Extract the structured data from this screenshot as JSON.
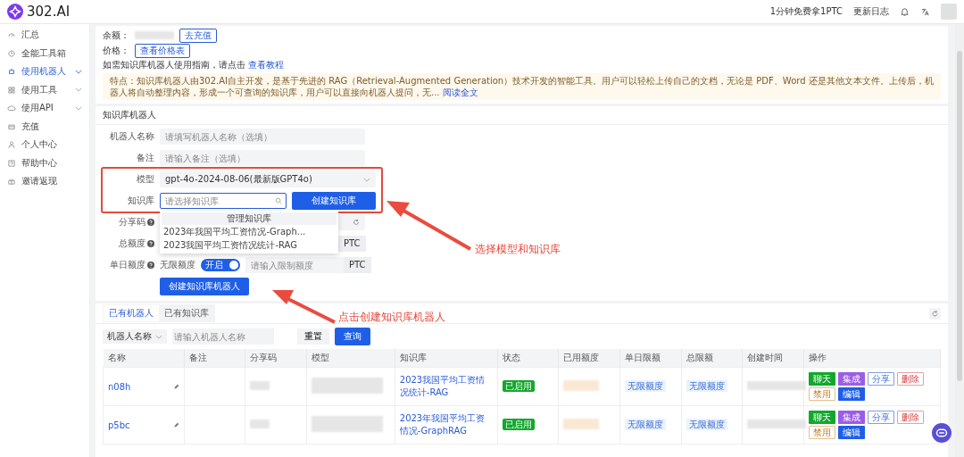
{
  "brand": {
    "name": "302.AI"
  },
  "topbar": {
    "promo": "1分钟免费拿1PTC",
    "changelog": "更新日志"
  },
  "sidebar": {
    "items": [
      {
        "label": "汇总",
        "selected": false,
        "expandable": false
      },
      {
        "label": "全能工具箱",
        "selected": false,
        "expandable": false
      },
      {
        "label": "使用机器人",
        "selected": true,
        "expandable": true
      },
      {
        "label": "使用工具",
        "selected": false,
        "expandable": true
      },
      {
        "label": "使用API",
        "selected": false,
        "expandable": true
      },
      {
        "label": "充值",
        "selected": false,
        "expandable": false
      },
      {
        "label": "个人中心",
        "selected": false,
        "expandable": false
      },
      {
        "label": "帮助中心",
        "selected": false,
        "expandable": false
      },
      {
        "label": "邀请返现",
        "selected": false,
        "expandable": false
      }
    ]
  },
  "account": {
    "balance_label": "余额：",
    "recharge_button": "去充值",
    "price_label": "价格：",
    "price_button": "查看价格表",
    "guide": "如需知识库机器人使用指南，请点击",
    "guide_link": "查看教程",
    "notice": "特点：知识库机器人由302.AI自主开发，是基于先进的 RAG（Retrieval-Augmented Generation）技术开发的智能工具。用户可以轻松上传自己的文档，无论是 PDF、Word 还是其他文本文件。上传后，机器人将自动整理内容，形成一个可查询的知识库，用户可以直接向机器人提问，无...",
    "notice_link": "阅读全文"
  },
  "form": {
    "title": "知识库机器人",
    "name": {
      "label": "机器人名称",
      "placeholder": "请填写机器人名称（选填）"
    },
    "note": {
      "label": "备注",
      "placeholder": "请输入备注（选填）"
    },
    "model": {
      "label": "模型",
      "value": "gpt-4o-2024-08-06(最新版GPT4o)"
    },
    "knowledge": {
      "label": "知识库",
      "placeholder": "请选择知识库",
      "create_button": "创建知识库",
      "dropdown": {
        "manage_button": "管理知识库",
        "options": [
          "2023年我国平均工资情况-Graph...",
          "2023我国平均工资情况统计-RAG"
        ]
      }
    },
    "share_code": {
      "label": "分享码"
    },
    "total_quota": {
      "label": "总额度",
      "unit": "PTC"
    },
    "daily_quota": {
      "label": "单日额度",
      "unlimited_label": "无限额度",
      "toggle": {
        "on": true,
        "text": "开启"
      },
      "placeholder": "请输入限制额度",
      "unit": "PTC"
    },
    "submit": "创建知识库机器人"
  },
  "annotations": [
    {
      "text": "选择模型和知识库"
    },
    {
      "text": "点击创建知识库机器人"
    }
  ],
  "list": {
    "tabs": [
      {
        "label": "已有机器人",
        "selected": true
      },
      {
        "label": "已有知识库",
        "selected": false
      }
    ],
    "filter": {
      "field": "机器人名称",
      "placeholder": "请输入机器人名称",
      "reset": "重置",
      "search": "查询"
    },
    "columns": [
      "名称",
      "备注",
      "分享码",
      "模型",
      "知识库",
      "状态",
      "已用额度",
      "单日限额",
      "总限额",
      "创建时间",
      "操作"
    ],
    "rows": [
      {
        "name": "n08h",
        "knowledge": "2023我国平均工资情况统计-RAG",
        "status": "已启用",
        "daily": "无限额度",
        "total": "无限额度",
        "actions": [
          {
            "label": "聊天",
            "kind": "green"
          },
          {
            "label": "集成",
            "kind": "purple"
          },
          {
            "label": "分享",
            "kind": "outline-blue"
          },
          {
            "label": "删除",
            "kind": "outline-red"
          },
          {
            "label": "禁用",
            "kind": "outline-orange"
          },
          {
            "label": "编辑",
            "kind": "blue"
          }
        ]
      },
      {
        "name": "p5bc",
        "knowledge": "2023年我国平均工资情况-GraphRAG",
        "status": "已启用",
        "daily": "无限额度",
        "total": "无限额度",
        "actions": [
          {
            "label": "聊天",
            "kind": "green"
          },
          {
            "label": "集成",
            "kind": "purple"
          },
          {
            "label": "分享",
            "kind": "outline-blue"
          },
          {
            "label": "删除",
            "kind": "outline-red"
          },
          {
            "label": "禁用",
            "kind": "outline-orange"
          },
          {
            "label": "编辑",
            "kind": "blue"
          }
        ]
      }
    ]
  }
}
